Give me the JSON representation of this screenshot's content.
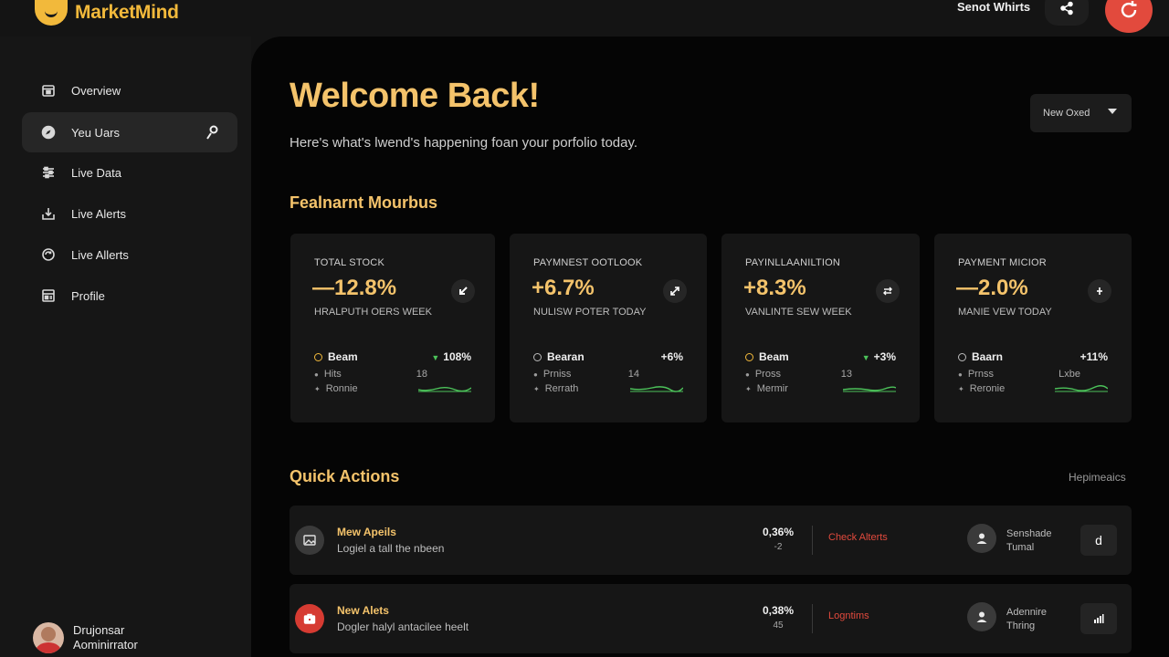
{
  "app": {
    "name": "MarketMind"
  },
  "topbar": {
    "link_label": "Senot Whirts"
  },
  "colors": {
    "accent": "#f4c36b",
    "brand": "#f2b93b",
    "danger": "#e24a3d",
    "positive": "#4cc35a"
  },
  "sidebar": {
    "items": [
      {
        "label": "Overview",
        "icon": "calendar-icon"
      },
      {
        "label": "Yeu Uars",
        "icon": "compass-icon",
        "active": true
      },
      {
        "label": "Live Data",
        "icon": "sliders-icon"
      },
      {
        "label": "Live Alerts",
        "icon": "download-icon"
      },
      {
        "label": "Live Allerts",
        "icon": "refresh-icon"
      },
      {
        "label": "Profile",
        "icon": "grid-icon"
      }
    ],
    "user": {
      "name": "Drujonsar",
      "role": "Aominirrator"
    }
  },
  "main": {
    "welcome": "Welcome Back!",
    "subtitle": "Here's what's lwend's happening foan your porfolio today.",
    "dropdown": "New Oxed",
    "section_title": "Fealnarnt Mourbus"
  },
  "cards": [
    {
      "label": "TOTAL STOCK",
      "value": "—12.8%",
      "sub": "HRALPUTH OERS WEEK",
      "row1_label": "Beam",
      "row1_value": "108%",
      "row1_up": true,
      "row2_label": "Hits",
      "row2_value": "18",
      "row3_label": "Ronnie"
    },
    {
      "label": "PAYMNEST OOTLOOK",
      "value": "+6.7%",
      "sub": "NULISW POTER TODAY",
      "row1_label": "Bearan",
      "row1_value": "+6%",
      "row1_up": false,
      "row2_label": "Prniss",
      "row2_value": "14",
      "row3_label": "Rerrath"
    },
    {
      "label": "PAYINLLAANILTION",
      "value": "+8.3%",
      "sub": "VANLINTE SEW WEEK",
      "row1_label": "Beam",
      "row1_value": "+3%",
      "row1_up": true,
      "row2_label": "Pross",
      "row2_value": "13",
      "row3_label": "Mermir"
    },
    {
      "label": "PAYMENT MICIOR",
      "value": "—2.0%",
      "sub": "MANIE VEW TODAY",
      "row1_label": "Baarn",
      "row1_value": "+11%",
      "row1_up": false,
      "row2_label": "Prnss",
      "row2_value": "Lxbe",
      "row3_label": "Reronie"
    }
  ],
  "quick_actions": {
    "title": "Quick Actions",
    "link": "Hepimeaics",
    "rows": [
      {
        "name": "Mew Apeils",
        "desc": "Logiel a tall the nbeen",
        "stat": "0,36%",
        "stat_sub": "-2",
        "action": "Check Alterts",
        "person_line1": "Senshade",
        "person_line2": "Tumal",
        "button_icon": "d"
      },
      {
        "name": "New Alets",
        "desc": "Dogler halyl antacilee heelt",
        "stat": "0,38%",
        "stat_sub": "45",
        "action": "Logntims",
        "person_line1": "Adennire",
        "person_line2": "Thring",
        "button_icon": "bars"
      }
    ]
  }
}
